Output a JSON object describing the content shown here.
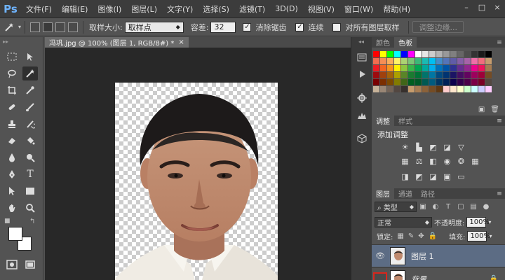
{
  "app": {
    "logo": "Ps"
  },
  "menu": [
    "文件(F)",
    "编辑(E)",
    "图像(I)",
    "图层(L)",
    "文字(Y)",
    "选择(S)",
    "滤镜(T)",
    "3D(D)",
    "视图(V)",
    "窗口(W)",
    "帮助(H)"
  ],
  "window_controls": {
    "minimize": "–",
    "restore": "□",
    "close": "×"
  },
  "options": {
    "tool_icon": "magic-wand-icon",
    "sample_size_label": "取样大小:",
    "sample_size_value": "取样点",
    "tolerance_label": "容差:",
    "tolerance_value": "32",
    "antialias_label": "消除锯齿",
    "antialias_checked": true,
    "contiguous_label": "连续",
    "contiguous_checked": true,
    "sample_all_label": "对所有图层取样",
    "sample_all_checked": false,
    "refine_edge_label": "调整边缘..."
  },
  "document": {
    "tab_title": "冯巩.jpg @ 100% (图层 1, RGB/8#) *",
    "tab_close": "×"
  },
  "panels": {
    "color_tabs": [
      "颜色",
      "色板"
    ],
    "adjust_tabs": [
      "调整",
      "样式"
    ],
    "adjust_title": "添加调整",
    "layer_tabs": [
      "图层",
      "通道",
      "路径"
    ],
    "filter_kind": "类型",
    "blend_mode": "正常",
    "opacity_label": "不透明度:",
    "opacity_value": "100%",
    "lock_label": "锁定:",
    "fill_label": "填充:",
    "fill_value": "100%"
  },
  "layers": [
    {
      "name": "图层 1",
      "visible": true,
      "selected": true
    },
    {
      "name": "背景",
      "visible": false,
      "selected": false
    }
  ],
  "colors": {
    "menu_bg": "#3c3c3c",
    "panel_bg": "#535353",
    "canvas_bg": "#282828",
    "selection_highlight": "#5c6c84",
    "red_outline": "#d9261c",
    "accent_blue": "#6fb4ff"
  },
  "swatches": [
    "#ff0000",
    "#ffff00",
    "#00ff00",
    "#00ffff",
    "#0000ff",
    "#ff00ff",
    "#ffffff",
    "#e6e6e6",
    "#cccccc",
    "#b3b3b3",
    "#999999",
    "#808080",
    "#666666",
    "#4d4d4d",
    "#333333",
    "#1a1a1a",
    "#000000",
    "#f26c4f",
    "#f68e55",
    "#fbaf5c",
    "#fff467",
    "#acd372",
    "#7cc576",
    "#3bb878",
    "#1abbb4",
    "#00bff3",
    "#438ccb",
    "#5574b9",
    "#605ca8",
    "#855fa8",
    "#a763a9",
    "#ef6ea8",
    "#f16d7e",
    "#c69c6d",
    "#ed1c24",
    "#f26522",
    "#f7941d",
    "#fff200",
    "#8dc63f",
    "#39b54a",
    "#00a651",
    "#00a99d",
    "#00aeef",
    "#0072bc",
    "#0054a6",
    "#2e3192",
    "#662d91",
    "#92278f",
    "#ec008c",
    "#ed145b",
    "#a67c52",
    "#9e0b0f",
    "#a0410d",
    "#a3620a",
    "#aba000",
    "#598527",
    "#197b30",
    "#007236",
    "#00746b",
    "#0076a3",
    "#004a80",
    "#003471",
    "#1b1464",
    "#440e62",
    "#630460",
    "#9e005d",
    "#9e0039",
    "#754c24",
    "#790000",
    "#7b2e00",
    "#7d4900",
    "#827b00",
    "#406618",
    "#005e20",
    "#005826",
    "#005952",
    "#005b7f",
    "#003663",
    "#002157",
    "#0d004c",
    "#32004b",
    "#4b0049",
    "#7b0046",
    "#7a0026",
    "#534741",
    "#c7b299",
    "#998675",
    "#736357",
    "#534741",
    "#37302d",
    "#c69c6d",
    "#a67c52",
    "#8c6239",
    "#754c24",
    "#603913",
    "#ffcccc",
    "#ffe6cc",
    "#ffffcc",
    "#ccffcc",
    "#ccffff",
    "#ccccff",
    "#ffccff"
  ]
}
